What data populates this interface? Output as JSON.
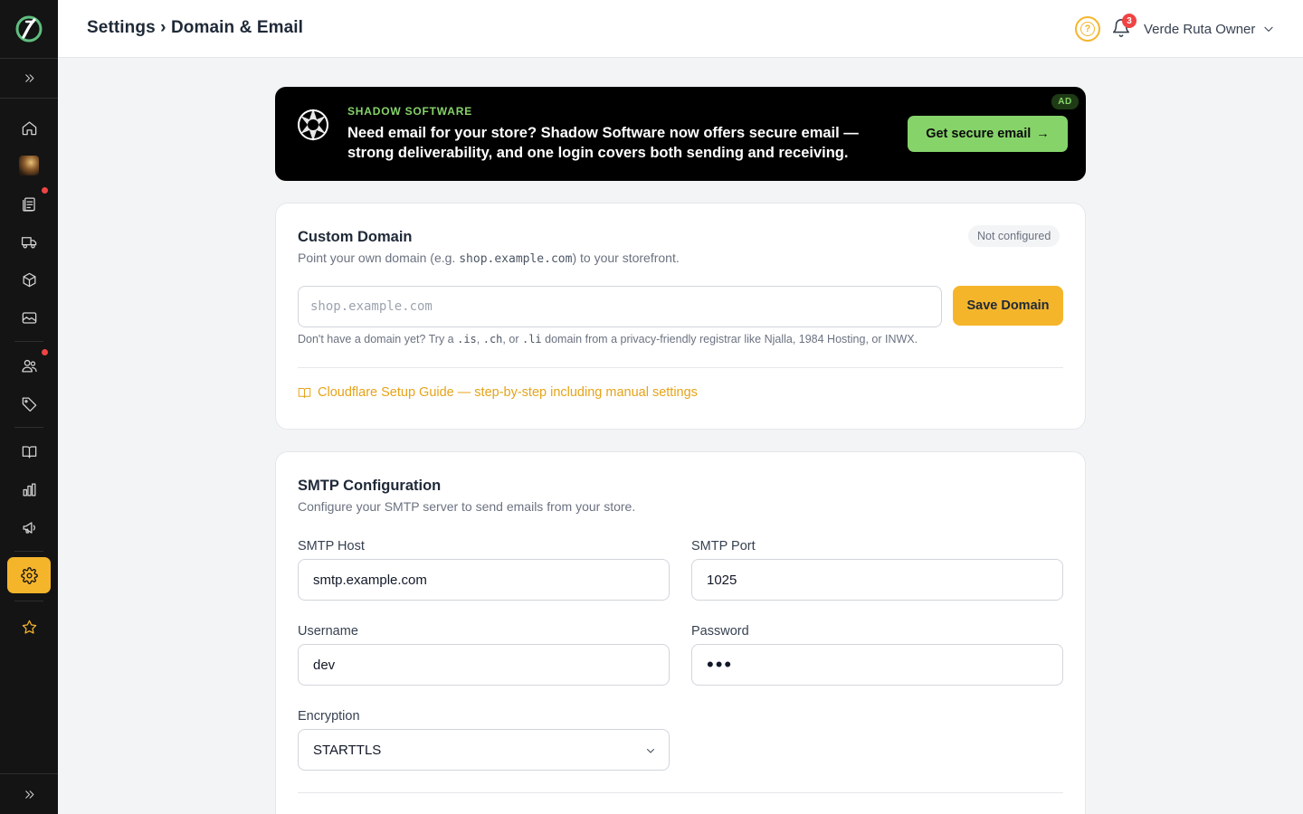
{
  "header": {
    "breadcrumb_parent": "Settings",
    "breadcrumb_separator": "›",
    "breadcrumb_current": "Domain & Email",
    "help_glyph": "?",
    "notification_count": "3",
    "user_name": "Verde Ruta Owner"
  },
  "sidebar": {
    "items": [
      {
        "name": "expand-icon"
      },
      {
        "name": "home-icon"
      },
      {
        "name": "store-avatar"
      },
      {
        "name": "orders-icon",
        "has_dot": true
      },
      {
        "name": "shipping-truck-icon"
      },
      {
        "name": "products-box-icon"
      },
      {
        "name": "media-image-icon"
      },
      {
        "name": "customers-icon",
        "has_dot": true
      },
      {
        "name": "tag-icon"
      },
      {
        "name": "book-icon"
      },
      {
        "name": "analytics-chart-icon"
      },
      {
        "name": "marketing-megaphone-icon"
      },
      {
        "name": "settings-gear-icon",
        "active": true
      },
      {
        "name": "star-icon"
      },
      {
        "name": "collapse-icon"
      }
    ],
    "accent_color": "#f5b52b"
  },
  "ad": {
    "brand": "SHADOW SOFTWARE",
    "message": "Need email for your store? Shadow Software now offers secure email — strong deliverability, and one login covers both sending and receiving.",
    "cta_label": "Get secure email",
    "cta_arrow": "→",
    "badge": "AD",
    "accent_color": "#86d36a"
  },
  "custom_domain": {
    "title": "Custom Domain",
    "desc_prefix": "Point your own domain (e.g. ",
    "desc_example": "shop.example.com",
    "desc_suffix": ") to your storefront.",
    "status": "Not configured",
    "input_value": "",
    "input_placeholder": "shop.example.com",
    "save_label": "Save Domain",
    "hint_prefix": "Don't have a domain yet? Try a ",
    "hint_tld1": ".is",
    "hint_sep1": ", ",
    "hint_tld2": ".ch",
    "hint_sep2": ", or ",
    "hint_tld3": ".li",
    "hint_suffix": " domain from a privacy-friendly registrar like Njalla, 1984 Hosting, or INWX.",
    "guide_label": "Cloudflare Setup Guide — step-by-step including manual settings"
  },
  "smtp": {
    "title": "SMTP Configuration",
    "desc": "Configure your SMTP server to send emails from your store.",
    "host_label": "SMTP Host",
    "host_value": "smtp.example.com",
    "port_label": "SMTP Port",
    "port_value": "1025",
    "username_label": "Username",
    "username_value": "dev",
    "password_label": "Password",
    "password_value": "•••",
    "encryption_label": "Encryption",
    "encryption_value": "STARTTLS"
  }
}
